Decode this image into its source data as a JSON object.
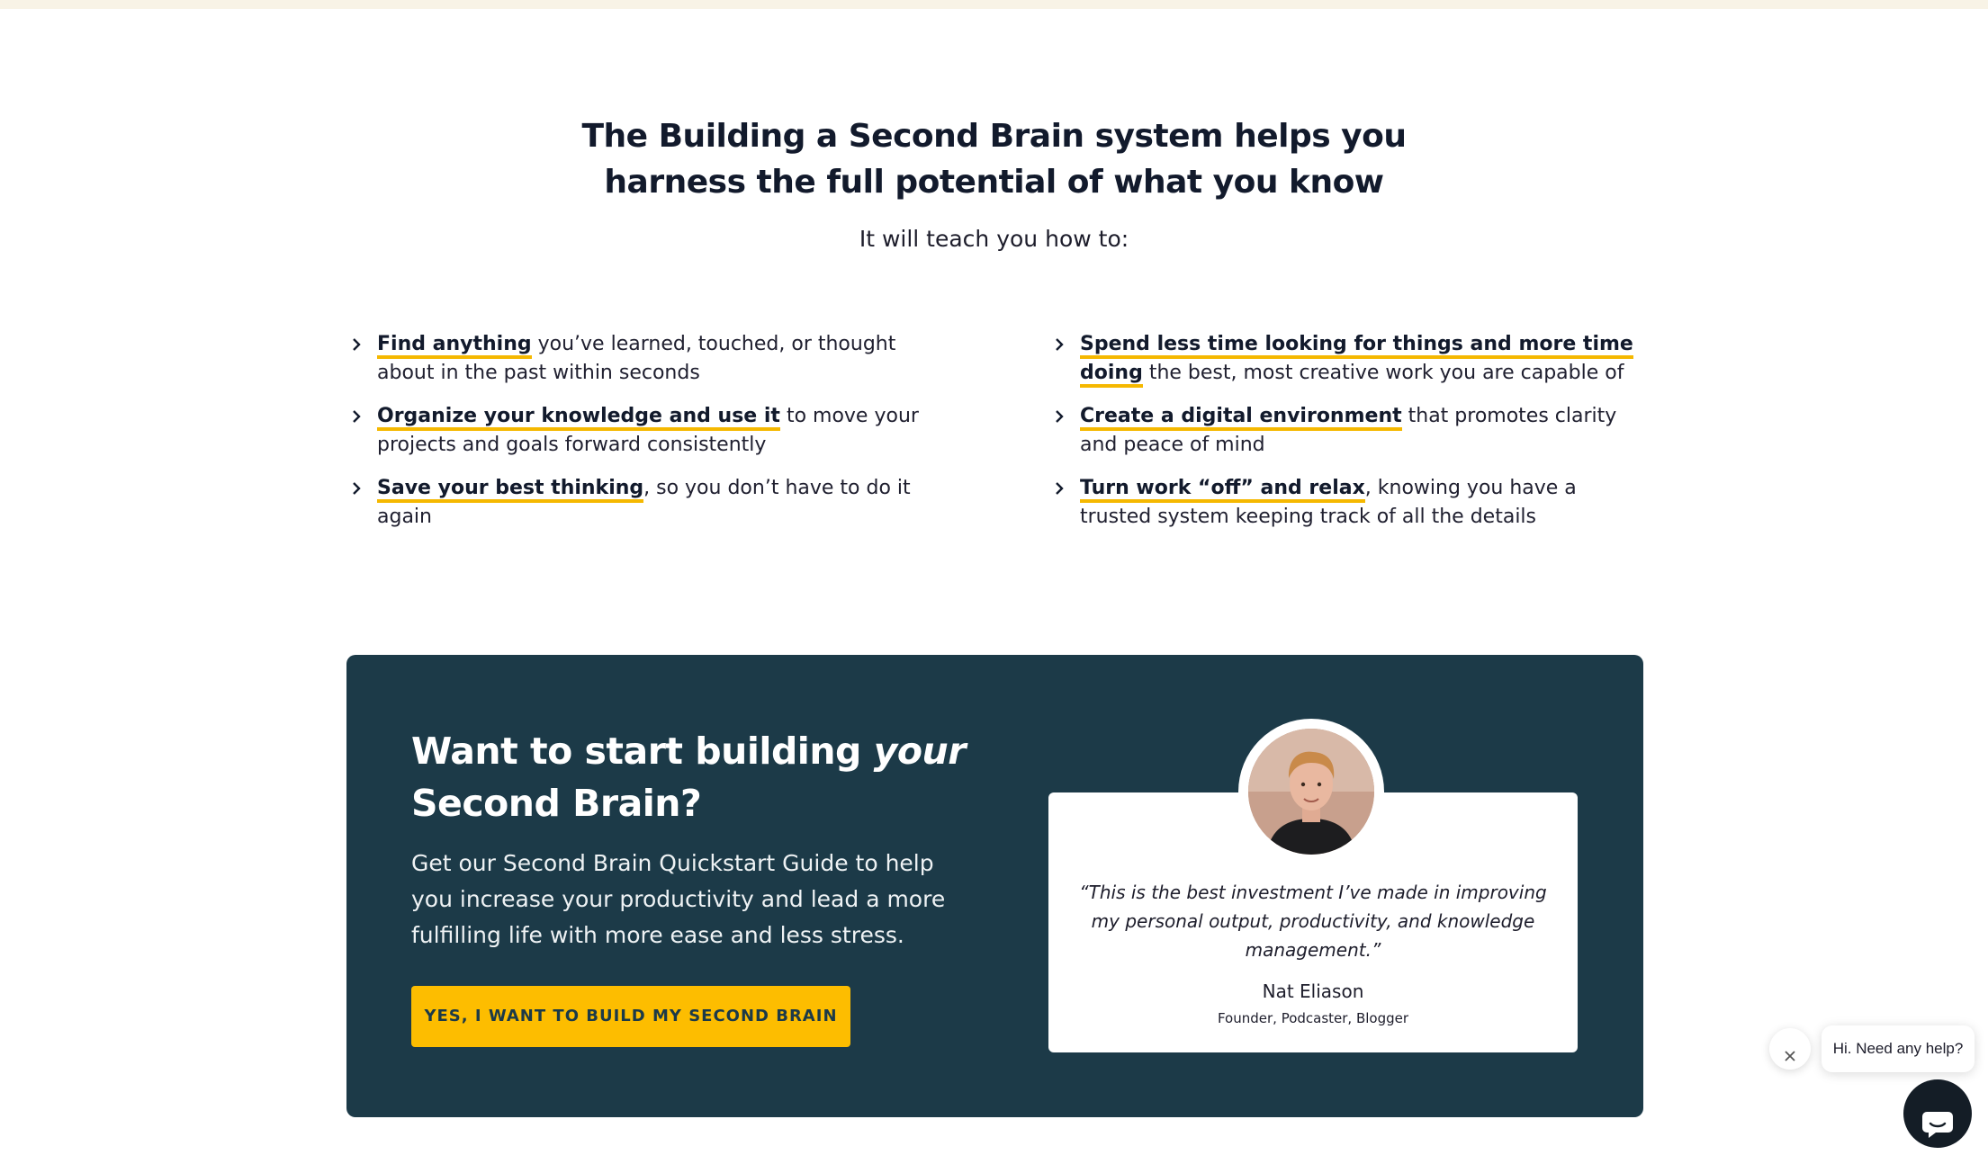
{
  "hero": {
    "headline_line1": "The Building a Second Brain system helps you",
    "headline_line2": "harness the full potential of what you know",
    "subhead": "It will teach you how to:"
  },
  "benefits": {
    "left": [
      {
        "highlight": "Find anything",
        "rest": " you’ve learned, touched, or thought about in the past within seconds"
      },
      {
        "highlight": "Organize your knowledge and use it",
        "rest": " to move your projects and goals forward consistently"
      },
      {
        "highlight": "Save your best thinking",
        "rest": ", so you don’t have to do it again"
      }
    ],
    "right": [
      {
        "highlight": "Spend less time looking for things and more time doing",
        "rest": " the best, most creative work you are capable of"
      },
      {
        "highlight": "Create a digital environment",
        "rest": " that promotes clarity and peace of mind"
      },
      {
        "highlight": "Turn work “off” and relax",
        "rest": ", knowing you have a trusted system keeping track of all the details"
      }
    ],
    "bullet_icon": "chevron-right-icon",
    "highlight_color": "#f5b800"
  },
  "cta": {
    "title_part1": "Want to start building ",
    "title_emphasis": "your",
    "title_part2": "Second Brain?",
    "text": "Get our Second Brain Quickstart Guide to help you increase your productivity and lead a more fulfilling life with more ease and less stress.",
    "button_label": "YES, I WANT TO BUILD MY SECOND BRAIN",
    "background_color": "#1c3a48",
    "button_color": "#fdbd00"
  },
  "testimonial": {
    "quote": "“This is the best investment I’ve made in improving my personal output, productivity, and knowledge management.”",
    "author_name": "Nat Eliason",
    "author_role": "Founder, Podcaster, Blogger",
    "avatar_icon": "avatar-photo"
  },
  "chat_widget": {
    "message": "Hi. Need any help?",
    "close_icon": "close-icon",
    "launcher_icon": "chat-bubble-icon"
  }
}
